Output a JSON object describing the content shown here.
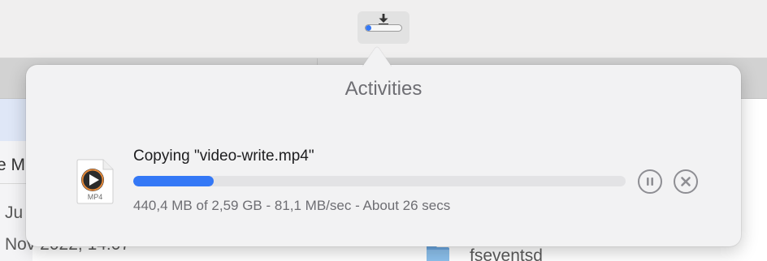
{
  "background": {
    "left_texts": [
      "e M",
      "Ju",
      "Nov 2022, 14:07"
    ],
    "folder_name": "fseventsd"
  },
  "toolbar": {
    "activity_button_icon": "download-arrow-icon",
    "mini_progress_fraction": 0.17
  },
  "popover": {
    "title": "Activities",
    "item": {
      "file_icon": "mp4-video-file-icon",
      "file_ext": "MP4",
      "title": "Copying \"video-write.mp4\"",
      "progress_fraction": 0.163,
      "status": "440,4 MB of 2,59 GB - 81,1 MB/sec - About 26 secs",
      "pause_icon": "pause-circle-icon",
      "cancel_icon": "cancel-circle-icon"
    }
  },
  "colors": {
    "accent": "#3478f6",
    "control_gray": "#8e8e93",
    "title_gray": "#6e6e73"
  }
}
